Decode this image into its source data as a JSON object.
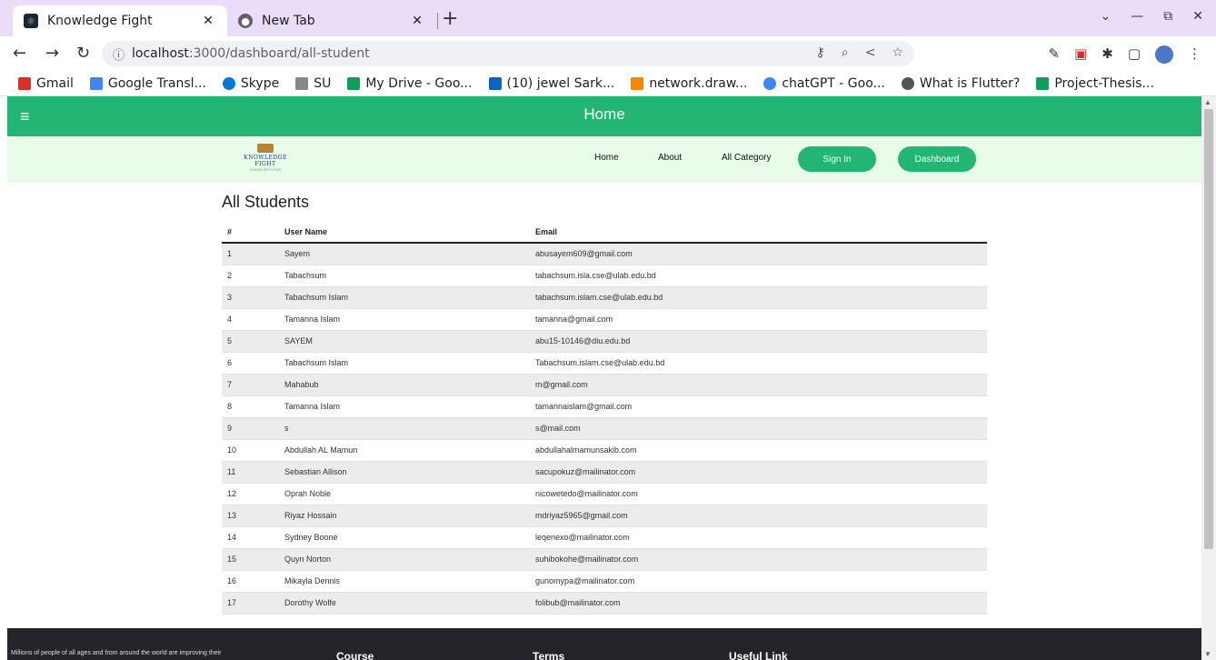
{
  "browser": {
    "tabs": [
      {
        "title": "Knowledge Fight",
        "active": true,
        "icon": "react-icon"
      },
      {
        "title": "New Tab",
        "active": false,
        "icon": "chrome-icon"
      }
    ],
    "url_host": "localhost",
    "url_path": ":3000/dashboard/all-student",
    "bookmarks": [
      {
        "label": "Gmail",
        "color": "#d93025"
      },
      {
        "label": "Google Transl...",
        "color": "#4285f4"
      },
      {
        "label": "Skype",
        "color": "#0078d4"
      },
      {
        "label": "SU",
        "color": "#888888"
      },
      {
        "label": "My Drive - Goo...",
        "color": "#0f9d58"
      },
      {
        "label": "(10) jewel Sark...",
        "color": "#0a66c2"
      },
      {
        "label": "network.draw...",
        "color": "#f08705"
      },
      {
        "label": "chatGPT - Goo...",
        "color": "#4285f4"
      },
      {
        "label": "What is Flutter?",
        "color": "#555555"
      },
      {
        "label": "Project-Thesis...",
        "color": "#0f9d58"
      }
    ]
  },
  "appbar": {
    "title": "Home",
    "color": "#22b573"
  },
  "logo": {
    "title": "KNOWLEDGE FIGHT",
    "subtitle": "LEARN WITH FUN"
  },
  "nav": {
    "home": "Home",
    "about": "About",
    "category": "All Category",
    "signin": "Sign In",
    "dashboard": "Dashboard"
  },
  "page_title": "All Students",
  "table": {
    "headers": [
      "#",
      "User Name",
      "Email"
    ],
    "rows": [
      {
        "num": "1",
        "name": "Sayem",
        "email": "abusayem609@gmail.com"
      },
      {
        "num": "2",
        "name": "Tabachsum",
        "email": "tabachsum.isla.cse@ulab.edu.bd"
      },
      {
        "num": "3",
        "name": "Tabachsum Islam",
        "email": "tabachsum.islam.cse@ulab.edu.bd"
      },
      {
        "num": "4",
        "name": "Tamanna Islam",
        "email": "tamanna@gmail.com"
      },
      {
        "num": "5",
        "name": "SAYEM",
        "email": "abu15-10146@diu.edu.bd"
      },
      {
        "num": "6",
        "name": "Tabachsum Islam",
        "email": "Tabachsum.islam.cse@ulab.edu.bd"
      },
      {
        "num": "7",
        "name": "Mahabub",
        "email": "m@gmail.com"
      },
      {
        "num": "8",
        "name": "Tamanna Islam",
        "email": "tamannaislam@gmail.com"
      },
      {
        "num": "9",
        "name": "s",
        "email": "s@mail.com"
      },
      {
        "num": "10",
        "name": "Abdullah AL Mamun",
        "email": "abdullahalmamunsakib.com"
      },
      {
        "num": "11",
        "name": "Sebastian Allison",
        "email": "sacupokuz@mailinator.com"
      },
      {
        "num": "12",
        "name": "Oprah Noble",
        "email": "nicowetedo@mailinator.com"
      },
      {
        "num": "13",
        "name": "Riyaz Hossain",
        "email": "mdriyaz5965@gmail.com"
      },
      {
        "num": "14",
        "name": "Sydney Boone",
        "email": "leqenexo@mailinator.com"
      },
      {
        "num": "15",
        "name": "Quyn Norton",
        "email": "suhibokohe@mailinator.com"
      },
      {
        "num": "16",
        "name": "Mikayla Dennis",
        "email": "gunomypa@mailinator.com"
      },
      {
        "num": "17",
        "name": "Dorothy Wolfe",
        "email": "folibub@mailinator.com"
      }
    ]
  },
  "footer": {
    "text": "Millions of people of all ages and from around the world are improving their",
    "course": "Course",
    "terms": "Terms",
    "useful": "Useful Link"
  }
}
